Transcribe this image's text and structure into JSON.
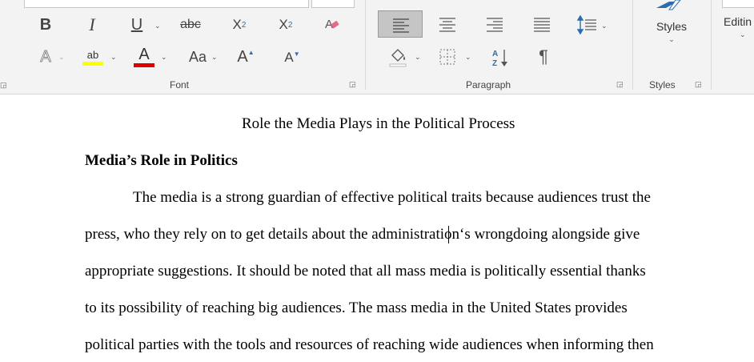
{
  "ribbon": {
    "font": {
      "group_label": "Font",
      "bold": "B",
      "italic": "I",
      "underline": "U",
      "strikethrough": "abc",
      "subscript_base": "X",
      "subscript_sub": "2",
      "superscript_base": "X",
      "superscript_sup": "2",
      "change_case": "Aa",
      "grow_font": "A",
      "shrink_font": "A",
      "text_effects": "A",
      "highlight_glyph": "ab",
      "font_color_glyph": "A",
      "highlight_color": "#ffff00",
      "font_color": "#e00000"
    },
    "paragraph": {
      "group_label": "Paragraph",
      "show_marks": "¶"
    },
    "styles": {
      "group_label": "Styles",
      "button_label": "Styles"
    },
    "editing": {
      "button_label": "Editin"
    }
  },
  "document": {
    "title": "Role the Media Plays in the Political Process",
    "heading": "Media’s Role in Politics",
    "lines": [
      "The media is a strong guardian of effective political traits because audiences trust the",
      "press, who they rely on to get details about the administration‘s wrongdoing alongside give",
      "appropriate suggestions. It should be noted that all mass media is politically essential thanks",
      "to its possibility of reaching big audiences. The mass media in the United States provides",
      "political parties with the tools and resources of reaching wide audiences when informing then"
    ]
  }
}
